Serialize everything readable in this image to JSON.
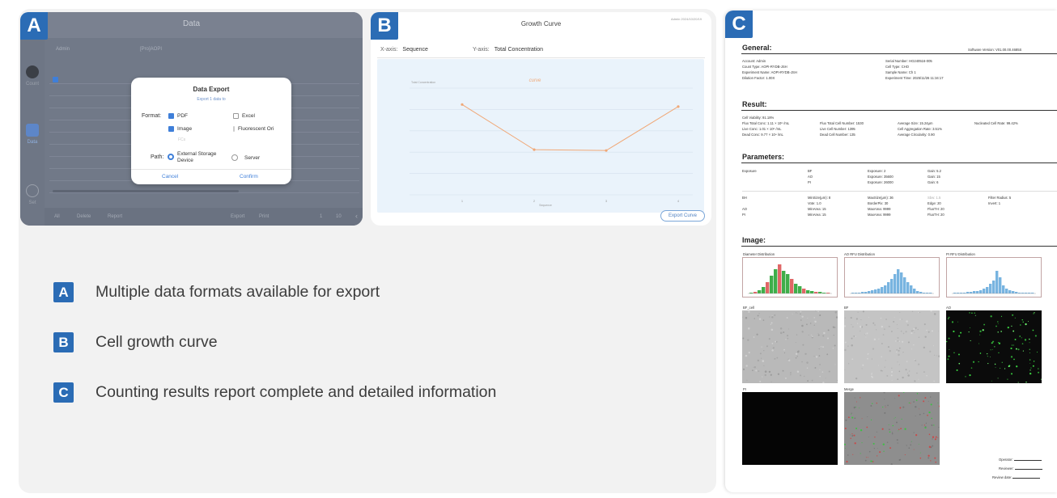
{
  "badges": {
    "a": "A",
    "b": "B",
    "c": "C"
  },
  "panel_a": {
    "window_title": "Data",
    "user": "Admin",
    "project": "[Pro]AOPI",
    "sidebar": [
      "Count",
      "Data",
      "Set"
    ],
    "dialog": {
      "title": "Data Export",
      "subtitle": "Export 1 data to",
      "format_label": "Format:",
      "formats": [
        {
          "label": "PDF",
          "checked": true
        },
        {
          "label": "Excel",
          "checked": false
        },
        {
          "label": "Image",
          "checked": true
        },
        {
          "label": "Fluorescent Ori",
          "checked": false
        },
        {
          "label": "FCs",
          "checked": false
        }
      ],
      "path_label": "Path:",
      "paths": [
        {
          "label": "External Storage Device",
          "selected": true
        },
        {
          "label": "Server",
          "selected": false
        }
      ],
      "cancel": "Cancel",
      "confirm": "Confirm"
    },
    "footer": {
      "all": "All",
      "delete": "Delete",
      "report": "Report",
      "export": "Export",
      "print": "Print",
      "page": "1",
      "pages": "10"
    }
  },
  "panel_b": {
    "title": "Growth Curve",
    "meta": "Admin  2024/10/20/19",
    "x_axis_label": "X-axis:",
    "x_axis_value": "Sequence",
    "y_axis_label": "Y-axis:",
    "y_axis_value": "Total Concentration",
    "export_button": "Export Curve"
  },
  "chart_data": {
    "type": "line",
    "title": "curve",
    "xlabel": "Sequence",
    "ylabel": "Total Concentration",
    "categories": [
      "1",
      "2",
      "3",
      "4"
    ],
    "series": [
      {
        "values": [
          2.2,
          1.1,
          1.08,
          2.15
        ]
      }
    ],
    "color": "#f0a877",
    "grid": true
  },
  "panel_c": {
    "software_version": "Software Version: V01.00.00.4685S",
    "sections": {
      "general": "General:",
      "result": "Result:",
      "parameters": "Parameters:",
      "image": "Image:"
    },
    "general_left": [
      "Account: Admin",
      "Count Type: AOPI-RYDB-JSH",
      "Experiment Name: AOPI-RYDB-JSH",
      "Dilution Factor: 1.00X"
    ],
    "general_right": [
      "Serial Number: HG240516-005",
      "Cell Type: CHO",
      "Sample Name: Ch 1",
      "Experiment Time: 2025/11/26 11:34:17"
    ],
    "result": [
      [
        "Cell Viability: 91.18%",
        "",
        "",
        ""
      ],
      [
        "Flux Total Conc: 1.11 × 10⁶ /mL",
        "Flux Total Cell Number: 1530",
        "Average Size: 15.24μm",
        "Nucleated Cell Rate: 99.42%"
      ],
      [
        "Live Conc: 1.01 × 10⁶ /mL",
        "Live Cell Number: 1395",
        "Cell Aggregation Rate: 3.51%",
        ""
      ],
      [
        "Dead Conc: 9.77 × 10⁴ /mL",
        "Dead Cell Number: 135",
        "Average Circularity: 0.90",
        ""
      ]
    ],
    "param_exposure": [
      [
        "Exposure",
        "BF",
        "Exposure: 2",
        "Gain: 5.2"
      ],
      [
        "",
        "AO",
        "Exposure: 35600",
        "Gain: 15"
      ],
      [
        "",
        "PI",
        "Exposure: 26000",
        "Gain: 6"
      ]
    ],
    "param_channels": [
      [
        "BH",
        "MinSize(μm): 8",
        "MaxSize(μm): 36",
        "Sbw: 1.5",
        "Filter Radius: 5"
      ],
      [
        "",
        "Vote: 1.0",
        "BorderPix: 30",
        "Edge: 20",
        "Invert: 1"
      ],
      [
        "AO",
        "MinArea: 15",
        "MaxArea: 9999",
        "FluoTH: 20",
        ""
      ],
      [
        "PI",
        "MinArea: 15",
        "MaxArea: 9999",
        "FluoTH: 20",
        ""
      ]
    ],
    "hist_titles": [
      "Diameter Distribution",
      "AO RFU Distribution",
      "PI RFU Distribution"
    ],
    "image_titles": [
      "BF_cell",
      "BF",
      "AO",
      "PI",
      "Merge"
    ],
    "signatures": [
      "Operator:",
      "Reviewer:",
      "Review date:"
    ]
  },
  "legend": [
    {
      "badge": "A",
      "text": "Multiple data formats available for export"
    },
    {
      "badge": "B",
      "text": "Cell growth curve"
    },
    {
      "badge": "C",
      "text": "Counting results report complete and detailed information"
    }
  ]
}
